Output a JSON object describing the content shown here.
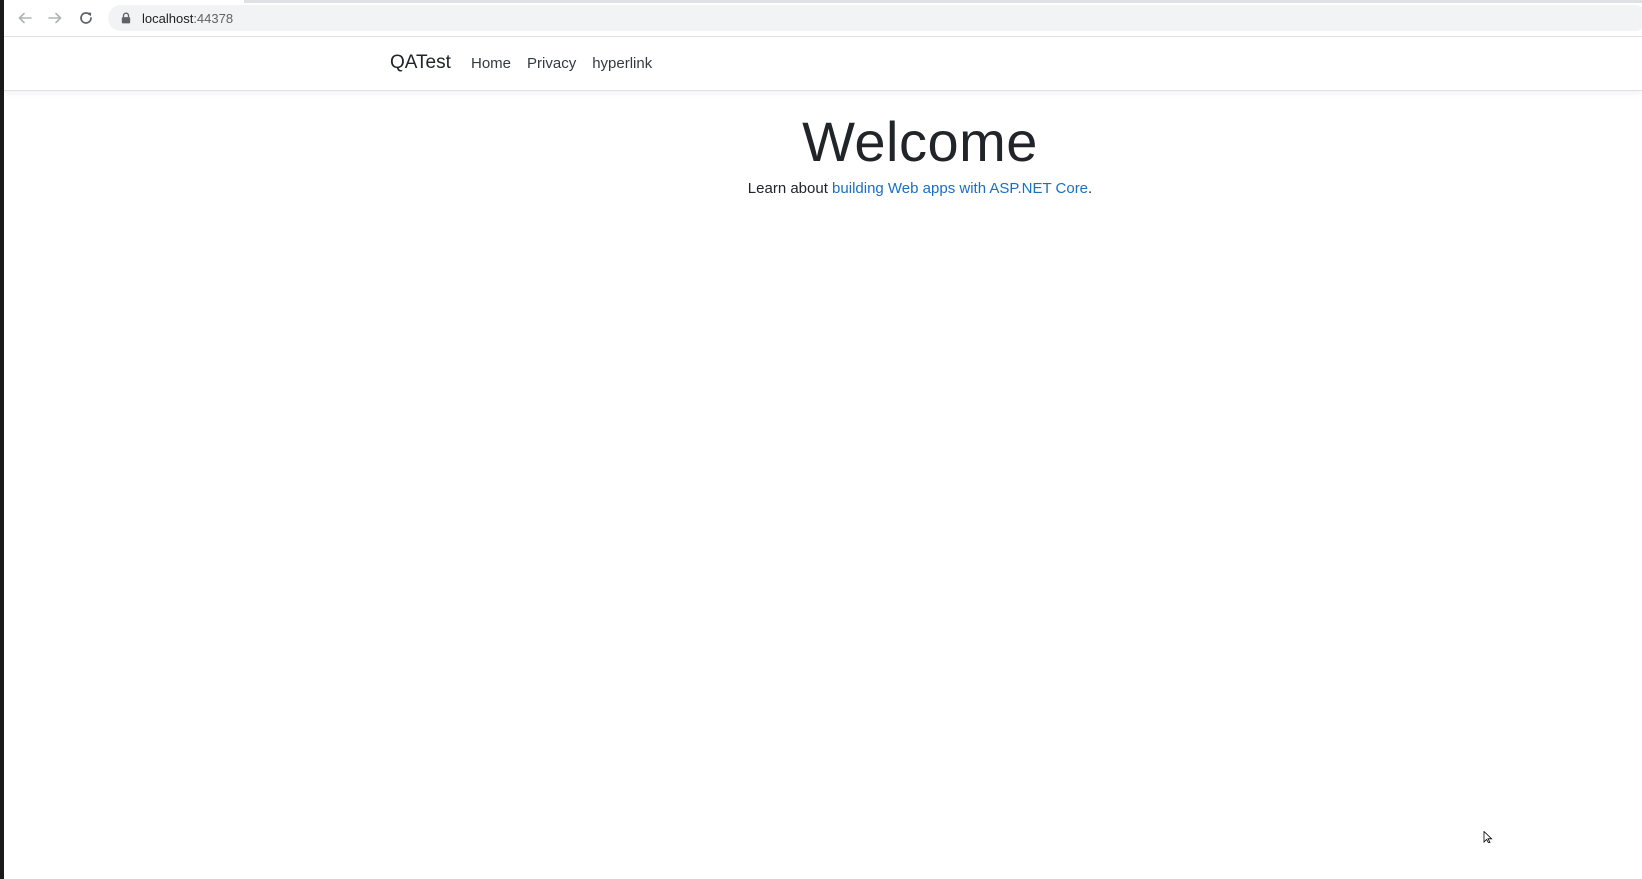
{
  "browser": {
    "url_host": "localhost",
    "url_port": ":44378",
    "back_icon": "arrow-left-icon",
    "forward_icon": "arrow-right-icon",
    "reload_icon": "reload-icon",
    "lock_icon": "lock-icon"
  },
  "navbar": {
    "brand": "QATest",
    "links": [
      "Home",
      "Privacy",
      "hyperlink"
    ]
  },
  "main": {
    "heading": "Welcome",
    "learn_prefix": "Learn about ",
    "learn_link": "building Web apps with ASP.NET Core",
    "learn_suffix": "."
  },
  "colors": {
    "link": "#1b6ec2",
    "text": "#212529",
    "omnibox_bg": "#f1f3f4"
  }
}
